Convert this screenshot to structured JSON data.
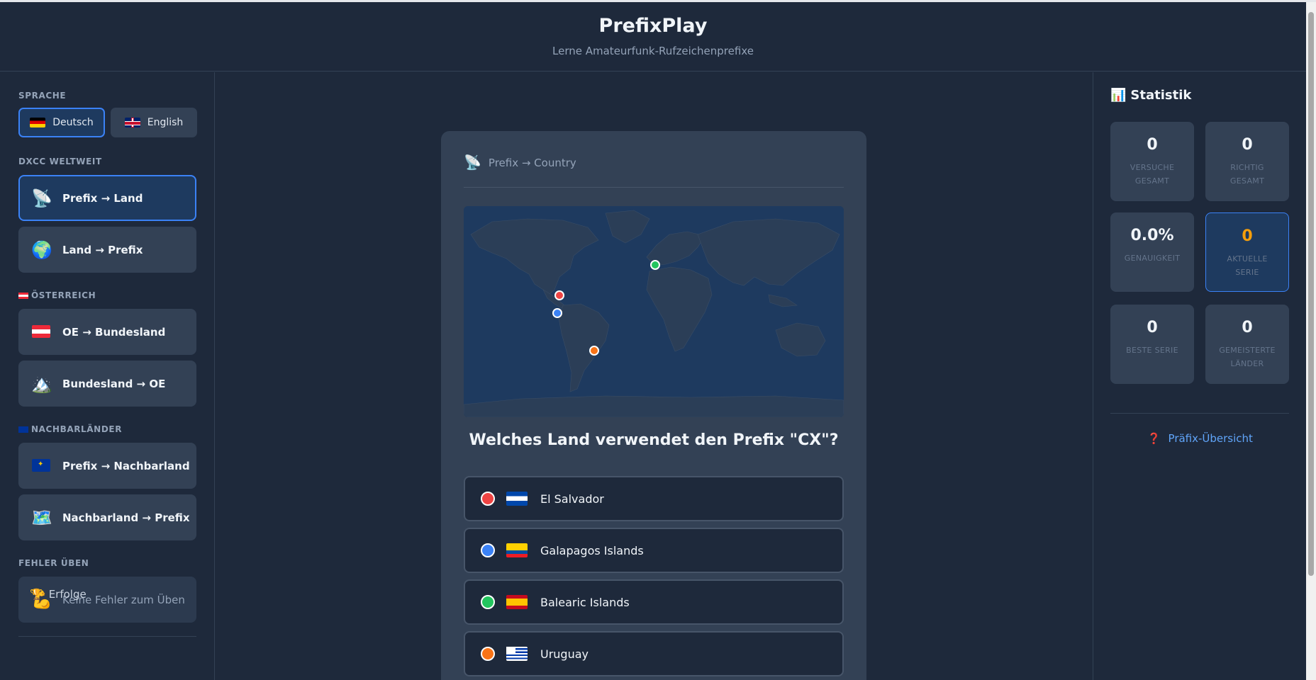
{
  "app": {
    "title": "PrefixPlay",
    "subtitle": "Lerne Amateurfunk-Rufzeichenprefixe"
  },
  "sidebar": {
    "language_heading": "SPRACHE",
    "languages": [
      {
        "label": "Deutsch",
        "active": true
      },
      {
        "label": "English",
        "active": false
      }
    ],
    "sections": {
      "dxcc": "DXCC WELTWEIT",
      "austria": "ÖSTERREICH",
      "neighbors": "NACHBARLÄNDER",
      "mistakes": "FEHLER ÜBEN"
    },
    "modes": {
      "prefix_land": {
        "icon": "📡",
        "label": "Prefix → Land",
        "active": true
      },
      "land_prefix": {
        "icon": "🌍",
        "label": "Land → Prefix"
      },
      "oe_bundesland": {
        "label": "OE → Bundesland"
      },
      "bundesland_oe": {
        "icon": "🏔️",
        "label": "Bundesland → OE"
      },
      "prefix_nachbarland": {
        "label": "Prefix → Nachbarland"
      },
      "nachbarland_prefix": {
        "icon": "🗺️",
        "label": "Nachbarland → Prefix"
      },
      "mistakes": {
        "icon": "💪",
        "label": "Keine Fehler zum Üben"
      }
    },
    "achievements": {
      "icon": "🏆",
      "label": "Erfolge"
    }
  },
  "quiz": {
    "mode_icon": "📡",
    "mode_label": "Prefix → Country",
    "question": "Welches Land verwendet den Prefix \"CX\"?",
    "answers": [
      {
        "label": "El Salvador",
        "color": "#ef4444"
      },
      {
        "label": "Galapagos Islands",
        "color": "#3b82f6"
      },
      {
        "label": "Balearic Islands",
        "color": "#22c55e"
      },
      {
        "label": "Uruguay",
        "color": "#f97316"
      }
    ]
  },
  "stats": {
    "icon": "📊",
    "title": "Statistik",
    "items": [
      {
        "value": "0",
        "label": "VERSUCHE GESAMT"
      },
      {
        "value": "0",
        "label": "RICHTIG GESAMT"
      },
      {
        "value": "0.0%",
        "label": "GENAUIGKEIT"
      },
      {
        "value": "0",
        "label": "AKTUELLE SERIE"
      },
      {
        "value": "0",
        "label": "BESTE SERIE"
      },
      {
        "value": "0",
        "label": "GEMEISTERTE LÄNDER"
      }
    ],
    "overview_icon": "❓",
    "overview_label": "Präfix-Übersicht"
  },
  "colors": {
    "accent": "#3b82f6",
    "background": "#1e293b",
    "panel": "#334155",
    "streak": "#f59e0b"
  }
}
